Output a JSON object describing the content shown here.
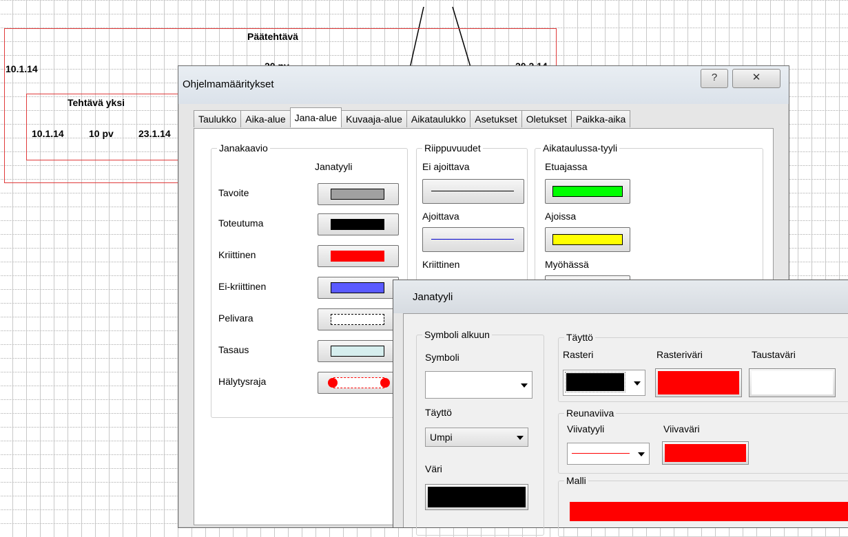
{
  "gantt": {
    "main_task": "Päätehtävä",
    "main_start": "10.1.14",
    "main_duration": "20 pv",
    "main_end": "20.2.14",
    "sub_task": "Tehtävä yksi",
    "sub_start": "10.1.14",
    "sub_duration": "10 pv",
    "sub_end": "23.1.14"
  },
  "settings_dialog": {
    "title": "Ohjelmamääritykset",
    "help_icon": "?",
    "close_icon": "✕",
    "tabs": [
      "Taulukko",
      "Aika-alue",
      "Jana-alue",
      "Kuvaaja-alue",
      "Aikataulukko",
      "Asetukset",
      "Oletukset",
      "Paikka-aika"
    ],
    "active_tab": "Jana-alue",
    "janakaavio": {
      "group_label": "Janakaavio",
      "column_header": "Janatyyli",
      "rows": [
        {
          "label": "Tavoite",
          "color": "#a0a0a0"
        },
        {
          "label": "Toteutuma",
          "color": "#000000"
        },
        {
          "label": "Kriittinen",
          "color": "#ff0000"
        },
        {
          "label": "Ei-kriittinen",
          "color": "#5a5aff"
        },
        {
          "label": "Pelivara",
          "color": "#ffffff"
        },
        {
          "label": "Tasaus",
          "color": "#d6eeee"
        },
        {
          "label": "Hälytysraja",
          "color": "#ff0000"
        }
      ]
    },
    "riippuvuudet": {
      "group_label": "Riippuvuudet",
      "items": [
        {
          "label": "Ei ajoittava",
          "color": "#000000"
        },
        {
          "label": "Ajoittava",
          "color": "#0000cc"
        },
        {
          "label": "Kriittinen",
          "color": "#ff0000"
        }
      ]
    },
    "aikataulussa": {
      "group_label": "Aikataulussa-tyyli",
      "items": [
        {
          "label": "Etuajassa",
          "color": "#00ff00"
        },
        {
          "label": "Ajoissa",
          "color": "#ffff00"
        },
        {
          "label": "Myöhässä",
          "color": "#cc0000"
        }
      ]
    }
  },
  "janatyyli_dialog": {
    "title": "Janatyyli",
    "symboli_group": "Symboli alkuun",
    "symboli_label": "Symboli",
    "symboli_value": "",
    "fill_label": "Täyttö",
    "fill_value": "Umpi",
    "color_label": "Väri",
    "color_value": "#000000",
    "tayttö_group": "Täyttö",
    "rasteri_label": "Rasteri",
    "rasteri_color": "#000000",
    "rasterivari_label": "Rasteriväri",
    "rasterivari_color": "#ff0000",
    "taustavari_label": "Taustaväri",
    "taustavari_color": "#ffffff",
    "reunaviiva_group": "Reunaviiva",
    "viivatyyli_label": "Viivatyyli",
    "viivatyyli_color": "#ff0000",
    "viivavari_label": "Viivaväri",
    "viivavari_color": "#ff0000",
    "malli_group": "Malli",
    "malli_color": "#ff0000"
  }
}
